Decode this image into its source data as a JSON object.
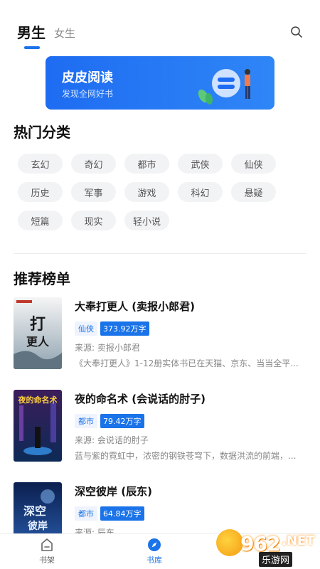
{
  "header": {
    "tabs": [
      {
        "label": "男生",
        "active": true
      },
      {
        "label": "女生",
        "active": false
      }
    ]
  },
  "banner": {
    "title": "皮皮阅读",
    "subtitle": "发现全网好书"
  },
  "categories": {
    "title": "热门分类",
    "items": [
      "玄幻",
      "奇幻",
      "都市",
      "武侠",
      "仙侠",
      "历史",
      "军事",
      "游戏",
      "科幻",
      "悬疑",
      "短篇",
      "现实",
      "轻小说"
    ]
  },
  "rankings": {
    "title": "推荐榜单",
    "books": [
      {
        "title": "大奉打更人 (卖报小郎君)",
        "genre": "仙侠",
        "word_count": "373.92万字",
        "source": "来源: 卖报小郎君",
        "description": "《大奉打更人》1-12册实体书已在天猫、京东、当当全平...",
        "cover_text": "打更人"
      },
      {
        "title": "夜的命名术 (会说话的肘子)",
        "genre": "都市",
        "word_count": "79.42万字",
        "source": "来源: 会说话的肘子",
        "description": "蓝与紫的霓虹中，浓密的钢铁苍穹下，数据洪流的前端，...",
        "cover_text": "夜的命名术"
      },
      {
        "title": "深空彼岸 (辰东)",
        "genre": "都市",
        "word_count": "64.84万字",
        "source": "来源: 辰东",
        "description": "",
        "cover_text": "深空彼岸"
      }
    ]
  },
  "bottom_nav": [
    {
      "label": "书架",
      "icon": "bookshelf-icon",
      "active": false
    },
    {
      "label": "书库",
      "icon": "compass-icon",
      "active": true
    }
  ],
  "watermark": {
    "number": "962",
    "suffix": ".NET",
    "text": "乐游网"
  },
  "colors": {
    "accent": "#1a73e8",
    "chip_bg": "#f2f3f5"
  }
}
